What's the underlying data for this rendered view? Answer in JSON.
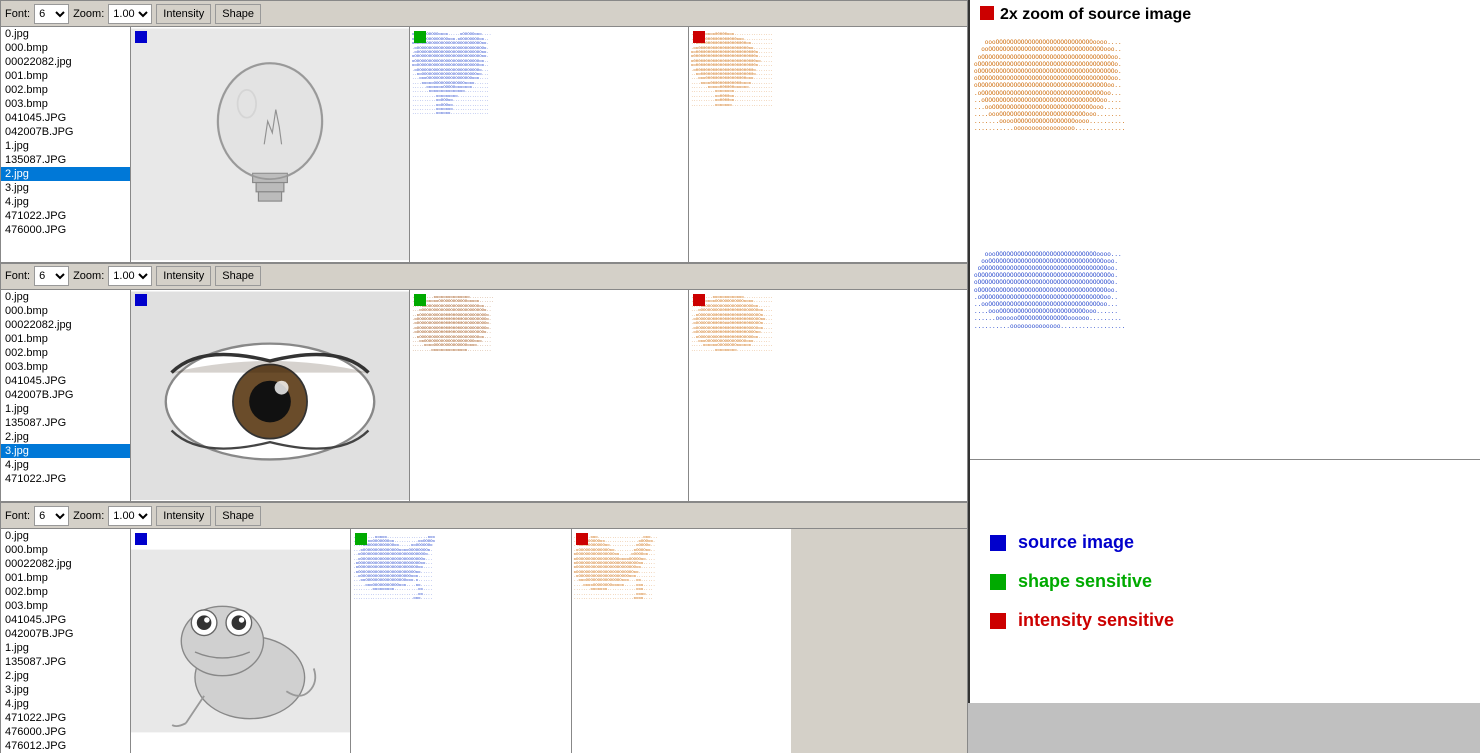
{
  "toolbar": {
    "font_label": "Font:",
    "zoom_label": "Zoom:",
    "font_value": "6",
    "zoom_value": "1.00",
    "intensity_label": "Intensity",
    "shape_label": "Shape"
  },
  "file_list": {
    "items": [
      "0.jpg",
      "000.bmp",
      "00022082.jpg",
      "001.bmp",
      "002.bmp",
      "003.bmp",
      "041045.JPG",
      "042007B.JPG",
      "1.jpg",
      "135087.JPG",
      "2.jpg",
      "3.jpg",
      "4.jpg",
      "471022.JPG",
      "476000.JPG",
      "476012.JPG"
    ],
    "selected": "2.jpg"
  },
  "legend": {
    "source_label": "source image",
    "shape_label": "shape sensitive",
    "intensity_label": "intensity sensitive",
    "zoom_title": "2x zoom of source image",
    "source_color": "#0000cc",
    "shape_color": "#00aa00",
    "intensity_color": "#cc0000"
  },
  "windows": [
    {
      "id": 1,
      "image": "lightbulb"
    },
    {
      "id": 2,
      "image": "eye"
    },
    {
      "id": 3,
      "image": "frog"
    }
  ]
}
